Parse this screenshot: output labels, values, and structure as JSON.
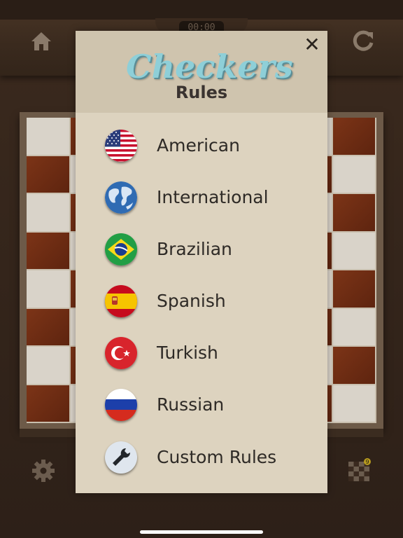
{
  "header": {
    "timer": "00:00",
    "home_icon": "home-icon",
    "restart_icon": "restart-icon"
  },
  "board": {
    "dark_color": "#6a2a12",
    "light_color": "#d9d3c9"
  },
  "footer": {
    "settings_icon": "gear-icon",
    "board_icon": "checkerboard-icon",
    "board_badge": "9"
  },
  "modal": {
    "brand": "Checkers",
    "subtitle": "Rules",
    "close_label": "✕",
    "items": [
      {
        "label": "American",
        "icon": "usa-flag-icon"
      },
      {
        "label": "International",
        "icon": "globe-icon"
      },
      {
        "label": "Brazilian",
        "icon": "brazil-flag-icon"
      },
      {
        "label": "Spanish",
        "icon": "spain-flag-icon"
      },
      {
        "label": "Turkish",
        "icon": "turkey-flag-icon"
      },
      {
        "label": "Russian",
        "icon": "russia-flag-icon"
      },
      {
        "label": "Custom Rules",
        "icon": "wrench-icon"
      }
    ]
  }
}
